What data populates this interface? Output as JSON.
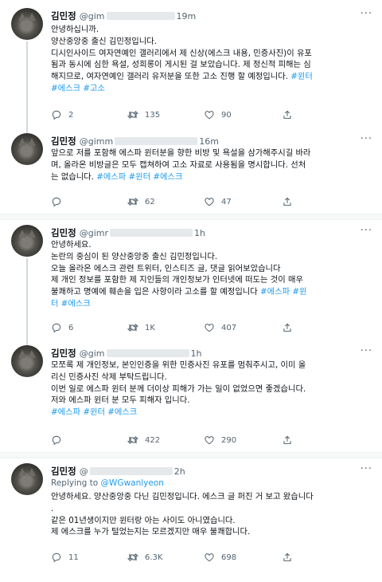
{
  "tweets": [
    {
      "name": "김민정",
      "handle": "@gim",
      "time": "19m",
      "lines": [
        [
          {
            "t": "안녕하십니까."
          }
        ],
        [
          {
            "t": "양산중앙중 출신 김민정입니다."
          }
        ],
        [
          {
            "t": "디시인사이드 여자연예인 갤러리에서 제 신상(에스크 내용, 민증사진)이 유포"
          }
        ],
        [
          {
            "t": "됨과 동시에 심한 욕설, 성희롱이 게시된 걸 보았습니다. 제 정신적 피해는 심"
          }
        ],
        [
          {
            "t": "해지므로, 여자연예인 갤러리 유저분을 또한 고소 진행 할 예정입니다. "
          },
          {
            "t": "#윈터",
            "tag": true
          }
        ],
        [
          {
            "t": "#에스크",
            "tag": true
          },
          {
            "t": " "
          },
          {
            "t": "#고소",
            "tag": true
          }
        ]
      ],
      "replies": "2",
      "retweets": "135",
      "likes": "90"
    },
    {
      "name": "김민정",
      "handle": "@gimm",
      "time": "16m",
      "lines": [
        [
          {
            "t": "앞으로 저를 포함해 에스파 윈터분을 향한 비방 및 욕설을 삼가해주시길 바라"
          }
        ],
        [
          {
            "t": "며, 올라온 비방글은 모두 캡쳐하여 고소 자료로 사용됨을 명시합니다. 선처"
          }
        ],
        [
          {
            "t": "는 없습니다. "
          },
          {
            "t": "#에스파",
            "tag": true
          },
          {
            "t": " "
          },
          {
            "t": "#윈터",
            "tag": true
          },
          {
            "t": " "
          },
          {
            "t": "#에스크",
            "tag": true
          }
        ]
      ],
      "replies": "",
      "retweets": "62",
      "likes": "47"
    },
    {
      "name": "김민정",
      "handle": "@gimr",
      "time": "1h",
      "lines": [
        [
          {
            "t": "안녕하세요."
          }
        ],
        [
          {
            "t": "논란의 중심이 된 양산중앙중 출신 김민정입니다."
          }
        ],
        [
          {
            "t": "오늘 올라온 에스크 관련 트위터, 인스티즈 글, 댓글 읽어보았습니다"
          }
        ],
        [
          {
            "t": "제 개인 정보를 포함한 제 지인들의 개인정보가 인터넷에 떠도는 것이 매우"
          }
        ],
        [
          {
            "t": "불쾌하고 명예에 훼손을 입은 사항이라 고소를 할 예정입니다 "
          },
          {
            "t": "#에스파",
            "tag": true
          },
          {
            "t": " "
          },
          {
            "t": "#윈",
            "tag": true
          }
        ],
        [
          {
            "t": "터",
            "tag": true
          },
          {
            "t": " "
          },
          {
            "t": "#에스크",
            "tag": true
          }
        ]
      ],
      "replies": "6",
      "retweets": "1K",
      "likes": "407"
    },
    {
      "name": "김민정",
      "handle": "@gim",
      "time": "1h",
      "lines": [
        [
          {
            "t": "모쪼록 제 개인정보, 본인인증을 위한 민증사진 유포를 멈춰주시고, 이미 올"
          }
        ],
        [
          {
            "t": "리신 민증사진 삭제 부탁드립니다."
          }
        ],
        [
          {
            "t": "이번 일로 에스파 윈터 분께 더이상 피해가 가는 일이 없었으면 좋겠습니다."
          }
        ],
        [
          {
            "t": "저와 에스파 윈터 분 모두 피해자 입니다."
          }
        ],
        [
          {
            "t": "#에스파",
            "tag": true
          },
          {
            "t": " "
          },
          {
            "t": "#윈터",
            "tag": true
          },
          {
            "t": " "
          },
          {
            "t": "#에스크",
            "tag": true
          }
        ]
      ],
      "replies": "",
      "retweets": "422",
      "likes": "290"
    },
    {
      "name": "김민정",
      "handle": "@",
      "time": "2h",
      "reply_prefix": "Replying to",
      "reply_handle": "@WGwanlyeon",
      "lines": [
        [
          {
            "t": "안녕하세요. 양산중앙중 다닌 김민정입니다. 에스크 글 퍼진 거 보고 왔습니다"
          }
        ],
        [
          {
            "t": "."
          }
        ],
        [
          {
            "t": "같은 01년생이지만 윈터랑 아는 사이도 아니였습니다."
          }
        ],
        [
          {
            "t": "제 에스크를 누가 털었는지는 모르겠지만 매우 불쾌합니다."
          }
        ]
      ],
      "replies": "11",
      "retweets": "6.3K",
      "likes": "698"
    }
  ],
  "icons": {
    "reply": "reply-icon",
    "retweet": "retweet-icon",
    "like": "heart-icon",
    "share": "share-icon",
    "more": "more-icon"
  },
  "colors": {
    "link": "#1d9bf0",
    "secondary": "#536471",
    "separator": "#f7f9f9"
  }
}
